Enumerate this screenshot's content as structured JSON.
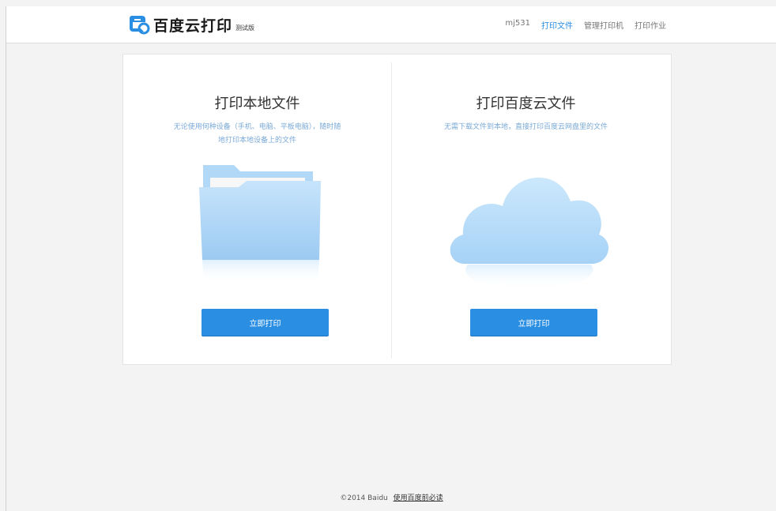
{
  "header": {
    "logo_text": "百度云打印",
    "logo_badge": "测试版",
    "nav": [
      {
        "label": "mj531",
        "active": false
      },
      {
        "label": "打印文件",
        "active": true
      },
      {
        "label": "管理打印机",
        "active": false
      },
      {
        "label": "打印作业",
        "active": false
      }
    ]
  },
  "cards": [
    {
      "title": "打印本地文件",
      "description": "无论使用何种设备（手机、电脑、平板电脑），随时随地打印本地设备上的文件",
      "icon": "folder-icon",
      "button_label": "立即打印"
    },
    {
      "title": "打印百度云文件",
      "description": "无需下载文件到本地，直接打印百度云网盘里的文件",
      "icon": "cloud-icon",
      "button_label": "立即打印"
    }
  ],
  "footer": {
    "copyright": "©2014 Baidu",
    "link_label": "使用百度前必读"
  },
  "colors": {
    "accent": "#2a8ee3",
    "folder": "#a9d4f7",
    "cloud": "#b8ddfa"
  }
}
